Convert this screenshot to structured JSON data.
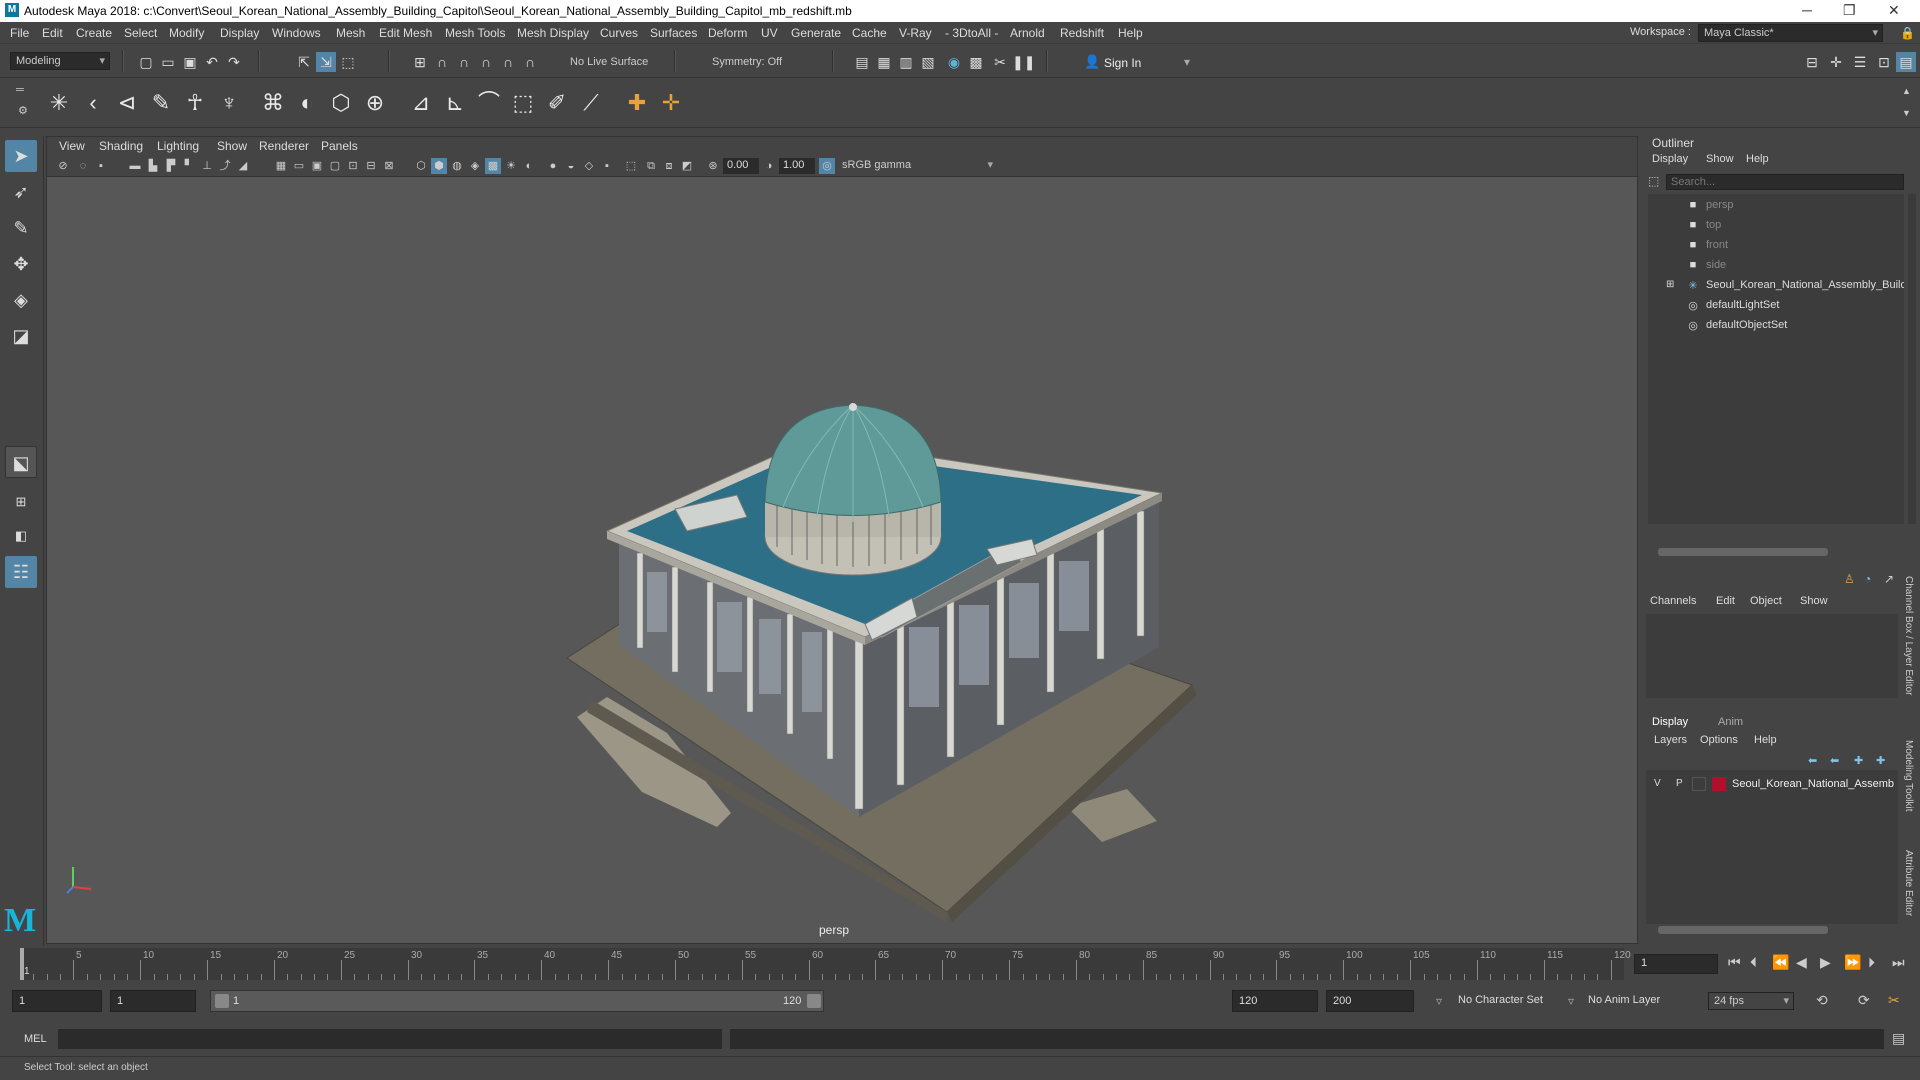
{
  "titlebar": {
    "title": "Autodesk Maya 2018: c:\\Convert\\Seoul_Korean_National_Assembly_Building_Capitol\\Seoul_Korean_National_Assembly_Building_Capitol_mb_redshift.mb"
  },
  "menubar": {
    "items": [
      "File",
      "Edit",
      "Create",
      "Select",
      "Modify",
      "Display",
      "Windows",
      "Mesh",
      "Edit Mesh",
      "Mesh Tools",
      "Mesh Display",
      "Curves",
      "Surfaces",
      "Deform",
      "UV",
      "Generate",
      "Cache",
      "V-Ray",
      "- 3DtoAll -",
      "Arnold",
      "Redshift",
      "Help"
    ],
    "workspace_label": "Workspace :",
    "workspace_value": "Maya Classic*"
  },
  "statusline": {
    "mode": "Modeling",
    "live_surface": "No Live Surface",
    "symmetry": "Symmetry: Off",
    "sign_in": "Sign In"
  },
  "viewport": {
    "menu": [
      "View",
      "Shading",
      "Lighting",
      "Show",
      "Renderer",
      "Panels"
    ],
    "exposure": "0.00",
    "gamma": "1.00",
    "color_space": "sRGB gamma",
    "camera_label": "persp"
  },
  "outliner": {
    "title": "Outliner",
    "menu": [
      "Display",
      "Show",
      "Help"
    ],
    "search_placeholder": "Search...",
    "items": [
      {
        "label": "persp",
        "icon": "camera-icon",
        "dim": true
      },
      {
        "label": "top",
        "icon": "camera-icon",
        "dim": true
      },
      {
        "label": "front",
        "icon": "camera-icon",
        "dim": true
      },
      {
        "label": "side",
        "icon": "camera-icon",
        "dim": true
      },
      {
        "label": "Seoul_Korean_National_Assembly_Buildi",
        "icon": "group-icon",
        "dim": false
      },
      {
        "label": "defaultLightSet",
        "icon": "set-icon",
        "dim": false
      },
      {
        "label": "defaultObjectSet",
        "icon": "set-icon",
        "dim": false
      }
    ]
  },
  "channelbox": {
    "menu": [
      "Channels",
      "Edit",
      "Object",
      "Show"
    ],
    "tabs": [
      "Display",
      "Anim"
    ],
    "layer_menu": [
      "Layers",
      "Options",
      "Help"
    ],
    "layer": {
      "v": "V",
      "p": "P",
      "name": "Seoul_Korean_National_Assemb",
      "color": "#b0102c"
    },
    "side_tabs": [
      "Channel Box / Layer Editor",
      "Modeling Toolkit",
      "Attribute Editor"
    ]
  },
  "timeline": {
    "tick_labels": [
      "5",
      "10",
      "15",
      "20",
      "25",
      "30",
      "35",
      "40",
      "45",
      "50",
      "55",
      "60",
      "65",
      "70",
      "75",
      "80",
      "85",
      "90",
      "95",
      "100",
      "105",
      "110",
      "115",
      "120"
    ],
    "current_marker": "1",
    "current_frame": "1"
  },
  "rangebar": {
    "start": "1",
    "playback_start": "1",
    "slider_start": "1",
    "slider_end": "120",
    "playback_end": "120",
    "end": "200",
    "character_set": "No Character Set",
    "anim_layer": "No Anim Layer",
    "fps": "24 fps"
  },
  "mel": {
    "label": "MEL"
  },
  "helpline": {
    "text": "Select Tool: select an object"
  },
  "colors": {
    "accent": "#5285a6",
    "bg": "#444444",
    "viewport": "#575757"
  }
}
